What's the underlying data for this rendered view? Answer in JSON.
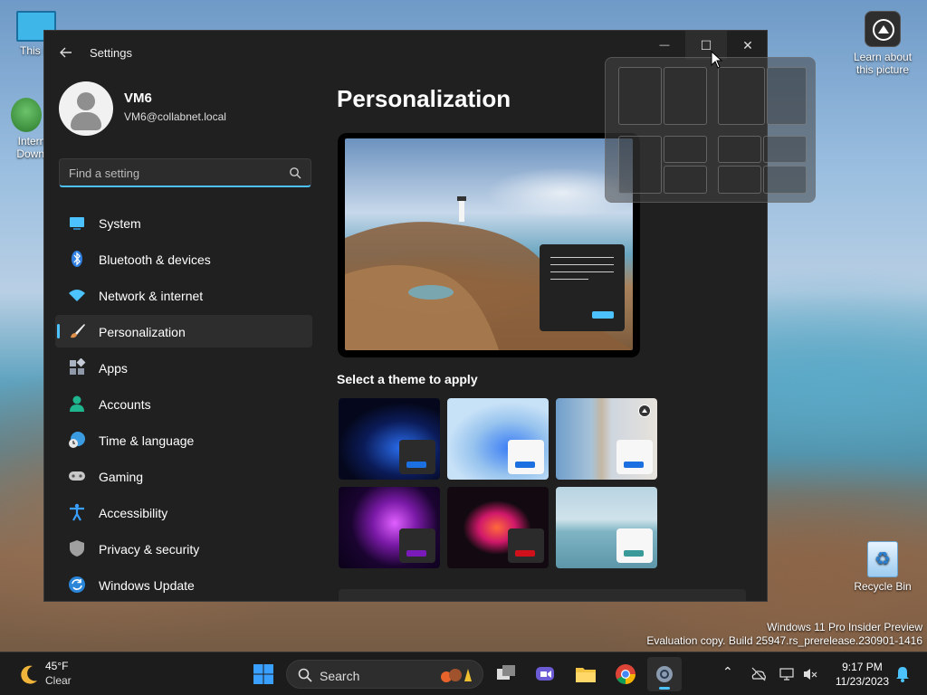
{
  "desktop": {
    "icons": [
      {
        "label": "This P"
      },
      {
        "label": "Intern\nDownl"
      }
    ],
    "learn_label": "Learn about this picture",
    "recycle_label": "Recycle Bin",
    "watermark_line1": "Windows 11 Pro Insider Preview",
    "watermark_line2": "Evaluation copy. Build 25947.rs_prerelease.230901-1416"
  },
  "window": {
    "title": "Settings",
    "caption": {
      "minimize": "—",
      "maximize": "☐",
      "close": "✕"
    }
  },
  "profile": {
    "name": "VM6",
    "email": "VM6@collabnet.local"
  },
  "search": {
    "placeholder": "Find a setting"
  },
  "nav": {
    "items": [
      {
        "label": "System",
        "icon": "monitor-icon",
        "color": "#4cc2ff"
      },
      {
        "label": "Bluetooth & devices",
        "icon": "bluetooth-icon",
        "color": "#3a8ee6"
      },
      {
        "label": "Network & internet",
        "icon": "wifi-icon",
        "color": "#4cc2ff"
      },
      {
        "label": "Personalization",
        "icon": "brush-icon",
        "color": "#e8a87c",
        "active": true
      },
      {
        "label": "Apps",
        "icon": "apps-icon",
        "color": "#9aa6b8"
      },
      {
        "label": "Accounts",
        "icon": "person-icon",
        "color": "#1fb58f"
      },
      {
        "label": "Time & language",
        "icon": "globe-clock-icon",
        "color": "#3a9be0"
      },
      {
        "label": "Gaming",
        "icon": "controller-icon",
        "color": "#bdbdbd"
      },
      {
        "label": "Accessibility",
        "icon": "accessibility-icon",
        "color": "#3aa0ff"
      },
      {
        "label": "Privacy & security",
        "icon": "shield-icon",
        "color": "#9a9a9a"
      },
      {
        "label": "Windows Update",
        "icon": "update-icon",
        "color": "#2a86d9"
      }
    ]
  },
  "content": {
    "title": "Personalization",
    "themes_heading": "Select a theme to apply",
    "themes": [
      {
        "name": "windows-dark",
        "accent": "#1c6fe0"
      },
      {
        "name": "windows-light",
        "accent": "#1c6fe0"
      },
      {
        "name": "spotlight",
        "accent": "#1c6fe0"
      },
      {
        "name": "glow",
        "accent": "#7a1ab8"
      },
      {
        "name": "captured-motion",
        "accent": "#d0101a"
      },
      {
        "name": "flow",
        "accent": "#3a9a9a"
      }
    ]
  },
  "taskbar": {
    "weather_temp": "45°F",
    "weather_cond": "Clear",
    "search_label": "Search",
    "time": "9:17 PM",
    "date": "11/23/2023"
  },
  "colors": {
    "accent": "#4cc2ff",
    "window_bg": "#202020"
  }
}
